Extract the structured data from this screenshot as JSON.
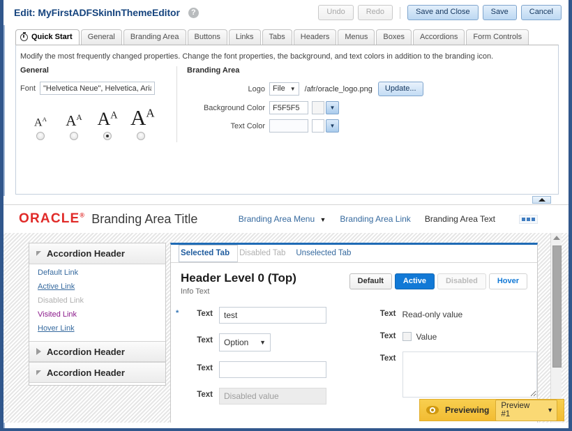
{
  "header": {
    "title": "Edit: MyFirstADFSkinInThemeEditor",
    "help_icon": "help-icon",
    "buttons": [
      {
        "label": "Undo",
        "state": "disabled"
      },
      {
        "label": "Redo",
        "state": "disabled"
      },
      {
        "label": "Save and Close",
        "state": "primary"
      },
      {
        "label": "Save",
        "state": "primary"
      },
      {
        "label": "Cancel",
        "state": "primary"
      }
    ]
  },
  "tabs": [
    {
      "label": "Quick Start",
      "active": true,
      "icon": "stopwatch-icon"
    },
    {
      "label": "General",
      "active": false
    },
    {
      "label": "Branding Area",
      "active": false
    },
    {
      "label": "Buttons",
      "active": false
    },
    {
      "label": "Links",
      "active": false
    },
    {
      "label": "Tabs",
      "active": false
    },
    {
      "label": "Headers",
      "active": false
    },
    {
      "label": "Menus",
      "active": false
    },
    {
      "label": "Boxes",
      "active": false
    },
    {
      "label": "Accordions",
      "active": false
    },
    {
      "label": "Form Controls",
      "active": false
    }
  ],
  "quick_start": {
    "description": "Modify the most frequently changed properties. Change the font properties, the background, and text colors in addition to the branding icon.",
    "general": {
      "title": "General",
      "font_label": "Font",
      "font_value": "\"Helvetica Neue\", Helvetica, Arial,",
      "font_sizes": [
        {
          "size": 16,
          "selected": false
        },
        {
          "size": 21,
          "selected": false
        },
        {
          "size": 26,
          "selected": true
        },
        {
          "size": 31,
          "selected": false
        }
      ]
    },
    "branding": {
      "title": "Branding Area",
      "logo_label": "Logo",
      "logo_type": "File",
      "logo_path": "/afr/oracle_logo.png",
      "update_button": "Update...",
      "background_color_label": "Background Color",
      "background_color_value": "F5F5F5",
      "background_color_hex": "#F5F5F5",
      "text_color_label": "Text Color",
      "text_color_value": ""
    }
  },
  "preview": {
    "brand": {
      "logo_text": "ORACLE",
      "logo_color": "#e02a28",
      "title": "Branding Area Title",
      "menu": "Branding Area Menu",
      "link": "Branding Area Link",
      "text": "Branding Area Text"
    },
    "accordion": [
      {
        "label": "Accordion Header",
        "expanded": true
      },
      {
        "label": "Accordion Header",
        "expanded": false
      },
      {
        "label": "Accordion Header",
        "expanded": true
      }
    ],
    "links": [
      {
        "label": "Default Link",
        "state": "default"
      },
      {
        "label": "Active Link",
        "state": "active"
      },
      {
        "label": "Disabled Link",
        "state": "disabled"
      },
      {
        "label": "Visited Link",
        "state": "visited"
      },
      {
        "label": "Hover Link",
        "state": "hover"
      }
    ],
    "content_tabs": [
      {
        "label": "Selected Tab",
        "state": "selected"
      },
      {
        "label": "Disabled Tab",
        "state": "disabled"
      },
      {
        "label": "Unselected Tab",
        "state": "unselected"
      }
    ],
    "card": {
      "heading": "Header Level 0 (Top)",
      "info_text": "Info Text",
      "buttons": [
        {
          "label": "Default",
          "state": "default"
        },
        {
          "label": "Active",
          "state": "active"
        },
        {
          "label": "Disabled",
          "state": "disabled"
        },
        {
          "label": "Hover",
          "state": "hover"
        }
      ],
      "left_fields": [
        {
          "label": "Text",
          "required": true,
          "type": "input",
          "value": "test"
        },
        {
          "label": "Text",
          "required": false,
          "type": "select",
          "value": "Option"
        },
        {
          "label": "Text",
          "required": false,
          "type": "input",
          "value": ""
        },
        {
          "label": "Text",
          "required": false,
          "type": "disabled",
          "value": "Disabled value"
        }
      ],
      "right_fields": [
        {
          "label": "Text",
          "type": "readonly",
          "value": "Read-only value"
        },
        {
          "label": "Text",
          "type": "checkbox",
          "value": "Value"
        },
        {
          "label": "Text",
          "type": "textarea",
          "value": ""
        }
      ]
    }
  },
  "toast": {
    "icon": "eye-icon",
    "label": "Previewing",
    "selected_preview": "Preview #1",
    "accent_color": "#f2bc33"
  }
}
